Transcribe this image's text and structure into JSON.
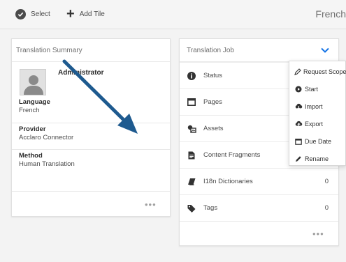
{
  "toolbar": {
    "select_label": "Select",
    "add_tile_label": "Add Tile",
    "page_language": "French"
  },
  "summary": {
    "title": "Translation Summary",
    "user_name": "Administrator",
    "language_label": "Language",
    "language_value": "French",
    "provider_label": "Provider",
    "provider_value": "Acclaro Connector",
    "method_label": "Method",
    "method_value": "Human Translation",
    "more": "•••"
  },
  "job": {
    "title": "Translation Job",
    "rows": [
      {
        "label": "Status",
        "count": ""
      },
      {
        "label": "Pages",
        "count": ""
      },
      {
        "label": "Assets",
        "count": ""
      },
      {
        "label": "Content Fragments",
        "count": ""
      },
      {
        "label": "I18n Dictionaries",
        "count": "0"
      },
      {
        "label": "Tags",
        "count": "0"
      }
    ],
    "more": "•••"
  },
  "menu": {
    "items": [
      {
        "label": "Request Scope"
      },
      {
        "label": "Start"
      },
      {
        "label": "Import"
      },
      {
        "label": "Export"
      },
      {
        "label": "Due Date"
      },
      {
        "label": "Rename"
      }
    ]
  },
  "colors": {
    "accent": "#1473e6",
    "arrow": "#1e5a8f",
    "icon": "#323232"
  }
}
